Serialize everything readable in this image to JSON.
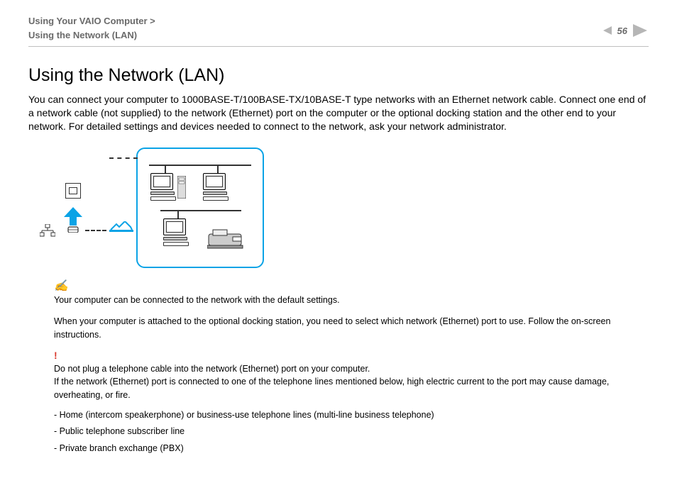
{
  "header": {
    "breadcrumb_line1": "Using Your VAIO Computer >",
    "breadcrumb_line2": "Using the Network (LAN)",
    "page_number": "56"
  },
  "title": "Using the Network (LAN)",
  "intro": "You can connect your computer to 1000BASE-T/100BASE-TX/10BASE-T type networks with an Ethernet network cable. Connect one end of a network cable (not supplied) to the network (Ethernet) port on the computer or the optional docking station and the other end to your network. For detailed settings and devices needed to connect to the network, ask your network administrator.",
  "note": {
    "line1": "Your computer can be connected to the network with the default settings.",
    "line2": "When your computer is attached to the optional docking station, you need to select which network (Ethernet) port to use. Follow the on-screen instructions."
  },
  "warning": {
    "line1": "Do not plug a telephone cable into the network (Ethernet) port on your computer.",
    "line2": "If the network (Ethernet) port is connected to one of the telephone lines mentioned below, high electric current to the port may cause damage, overheating, or fire.",
    "items": [
      "- Home (intercom speakerphone) or business-use telephone lines (multi-line business telephone)",
      "- Public telephone subscriber line",
      "- Private branch exchange (PBX)"
    ]
  }
}
